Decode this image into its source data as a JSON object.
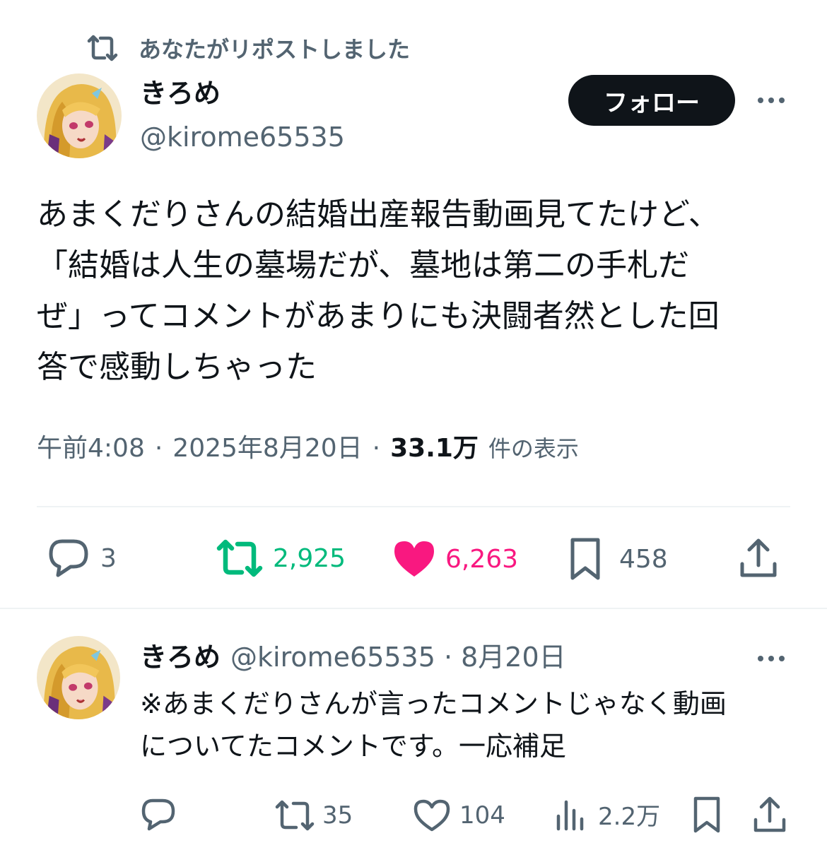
{
  "repost_banner": {
    "icon": "repost-icon",
    "text": "あなたがリポストしました"
  },
  "tweet": {
    "author_name": "きろめ",
    "author_handle": "@kirome65535",
    "follow_label": "フォロー",
    "text": "あまくだりさんの結婚出産報告動画見てたけど、\n「結婚は人生の墓場だが、墓地は第二の手札だ\nぜ」ってコメントがあまりにも決闘者然とした回\n答で感動しちゃった",
    "time": "午前4:08",
    "date": "2025年8月20日",
    "separator": "·",
    "views": "33.1万",
    "views_label": "件の表示",
    "stats": {
      "replies": "3",
      "reposts": "2,925",
      "likes": "6,263",
      "bookmarks": "458"
    }
  },
  "reply": {
    "author_name": "きろめ",
    "meta": "@kirome65535 · 8月20日",
    "text": "※あまくだりさんが言ったコメントじゃなく動画\nについてたコメントです。一応補足",
    "stats": {
      "reposts": "35",
      "likes": "104",
      "views": "2.2万"
    }
  },
  "colors": {
    "text": "#0f1419",
    "secondary": "#536471",
    "repost_green": "#00ba7c",
    "like_pink": "#f91880",
    "divider": "#eff3f4"
  }
}
